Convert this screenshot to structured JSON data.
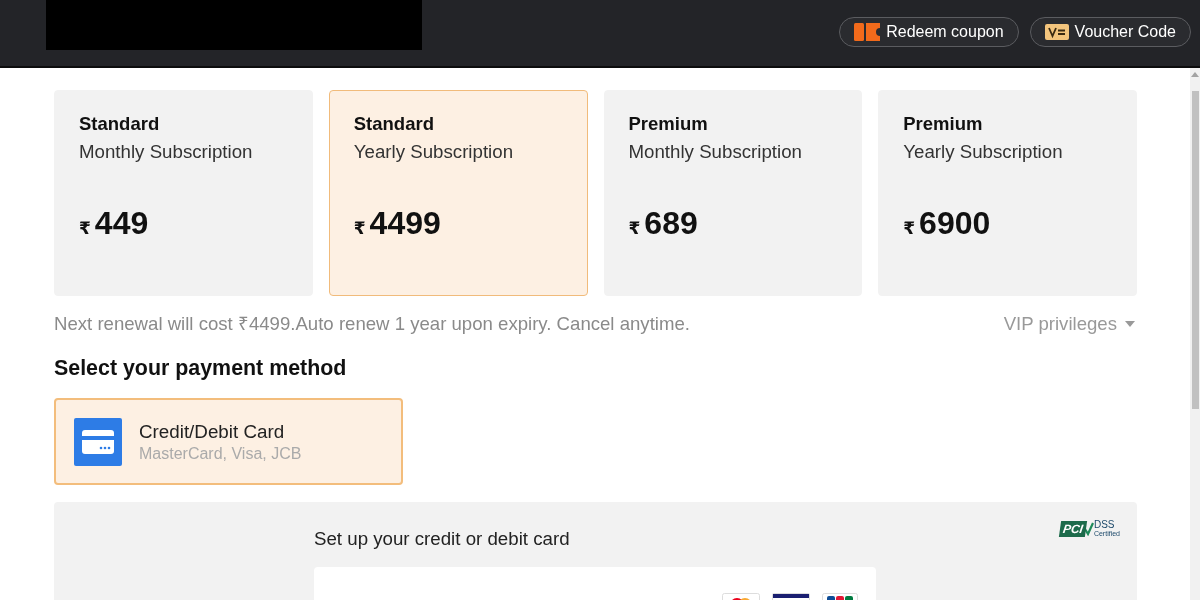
{
  "header": {
    "buttons": [
      {
        "kind": "coupon",
        "label": "Redeem coupon"
      },
      {
        "kind": "voucher",
        "label": "Voucher Code"
      }
    ]
  },
  "plans": [
    {
      "tier": "Standard",
      "period": "Monthly Subscription",
      "currency": "₹",
      "price": "449",
      "selected": false
    },
    {
      "tier": "Standard",
      "period": "Yearly Subscription",
      "currency": "₹",
      "price": "4499",
      "selected": true
    },
    {
      "tier": "Premium",
      "period": "Monthly Subscription",
      "currency": "₹",
      "price": "689",
      "selected": false
    },
    {
      "tier": "Premium",
      "period": "Yearly Subscription",
      "currency": "₹",
      "price": "6900",
      "selected": false
    }
  ],
  "renewal_note": "Next renewal will cost ₹4499.Auto renew 1 year upon expiry. Cancel anytime.",
  "vip_link": {
    "label": "VIP privileges"
  },
  "payment": {
    "heading": "Select your payment method",
    "methods": [
      {
        "title": "Credit/Debit Card",
        "subtitle": "MasterCard, Visa, JCB",
        "selected": true
      }
    ]
  },
  "card_form": {
    "heading": "Set up your credit or debit card",
    "badge": {
      "mark": "PCI",
      "label": "DSS",
      "note": "Certified"
    },
    "brands": [
      {
        "kind": "mastercard"
      },
      {
        "kind": "visa"
      },
      {
        "kind": "jcb"
      }
    ]
  }
}
